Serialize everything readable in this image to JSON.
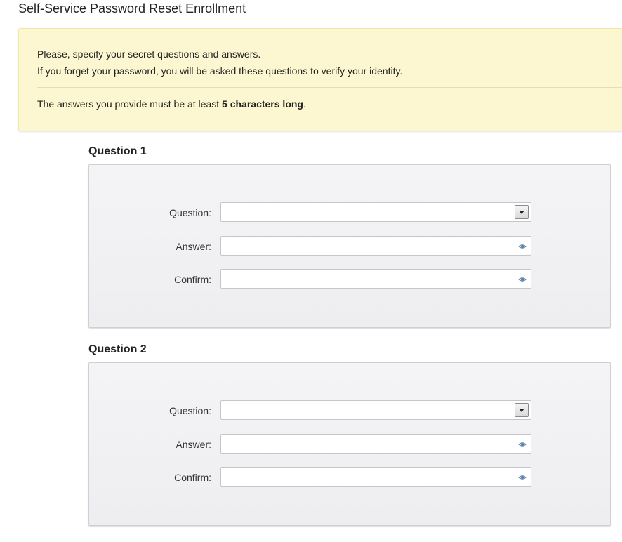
{
  "page": {
    "title": "Self-Service Password Reset Enrollment"
  },
  "info": {
    "line1": "Please, specify your secret questions and answers.",
    "line2": "If you forget your password, you will be asked these questions to verify your identity.",
    "line3_prefix": "The answers you provide must be at least ",
    "line3_bold": "5 characters long",
    "line3_suffix": "."
  },
  "questions": [
    {
      "heading": "Question 1",
      "question_label": "Question:",
      "question_value": "",
      "answer_label": "Answer:",
      "answer_value": "",
      "confirm_label": "Confirm:",
      "confirm_value": ""
    },
    {
      "heading": "Question 2",
      "question_label": "Question:",
      "question_value": "",
      "answer_label": "Answer:",
      "answer_value": "",
      "confirm_label": "Confirm:",
      "confirm_value": ""
    }
  ],
  "icons": {
    "dropdown": "chevron-down-icon",
    "reveal": "eye-icon"
  },
  "colors": {
    "info_background": "#fdf7d1",
    "panel_background": "#f1f1f4",
    "eye_icon": "#5b7fa6"
  }
}
